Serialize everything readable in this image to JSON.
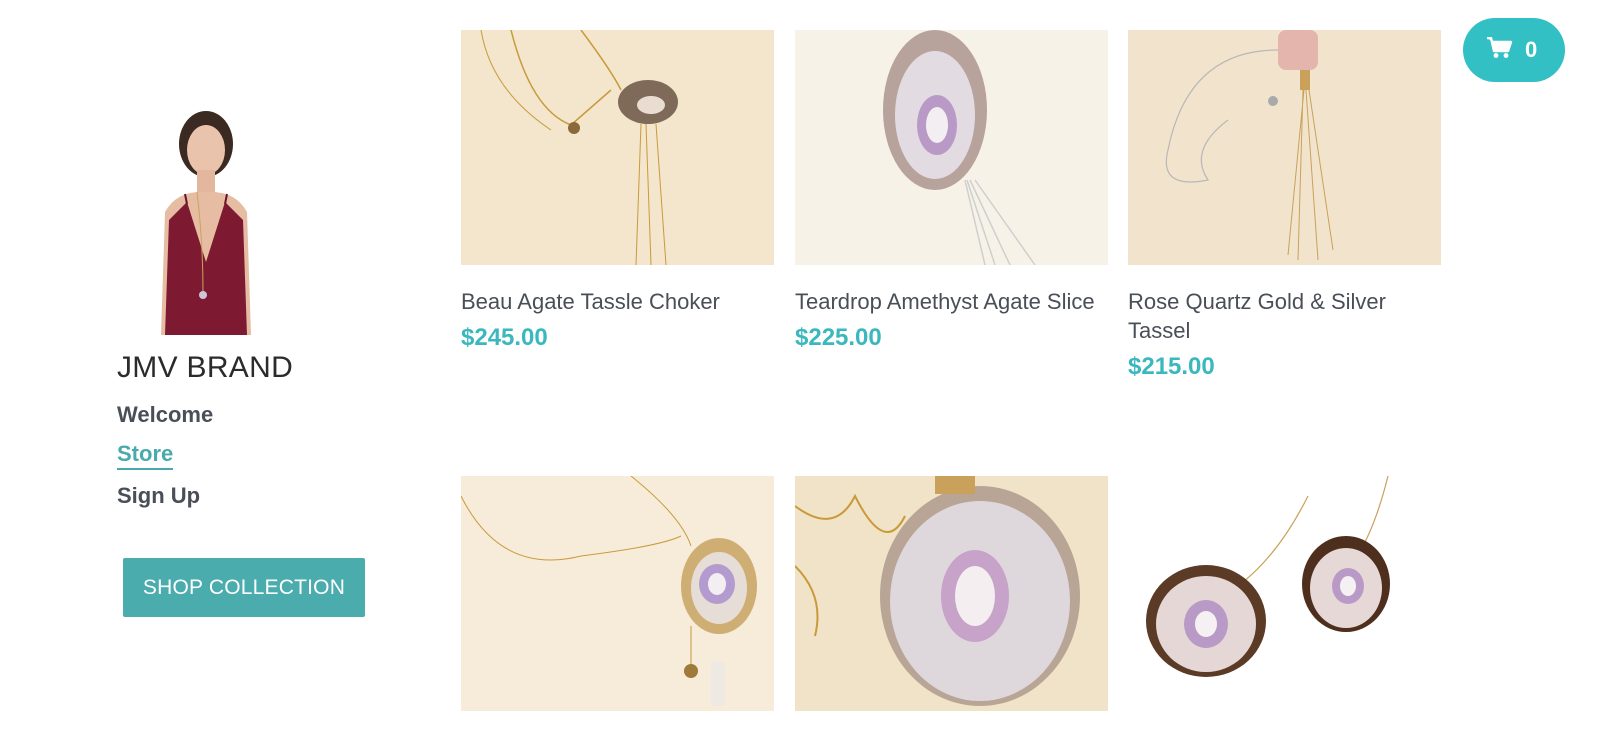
{
  "brand": {
    "name": "JMV BRAND"
  },
  "nav": {
    "items": [
      {
        "label": "Welcome",
        "active": false
      },
      {
        "label": "Store",
        "active": true
      },
      {
        "label": "Sign Up",
        "active": false
      }
    ]
  },
  "cta": {
    "label": "SHOP COLLECTION"
  },
  "cart": {
    "count": "0",
    "icon": "shopping-cart-icon"
  },
  "colors": {
    "accent": "#3ab8be",
    "button": "#4aacad",
    "cart": "#33c0c5",
    "text": "#4a4f57"
  },
  "products": [
    {
      "name": "Beau Agate Tassle Choker",
      "price": "$245.00"
    },
    {
      "name": "Teardrop Amethyst Agate Slice",
      "price": "$225.00"
    },
    {
      "name": "Rose Quartz Gold & Silver Tassel",
      "price": "$215.00"
    },
    {
      "name": "",
      "price": ""
    },
    {
      "name": "",
      "price": ""
    },
    {
      "name": "",
      "price": ""
    }
  ]
}
